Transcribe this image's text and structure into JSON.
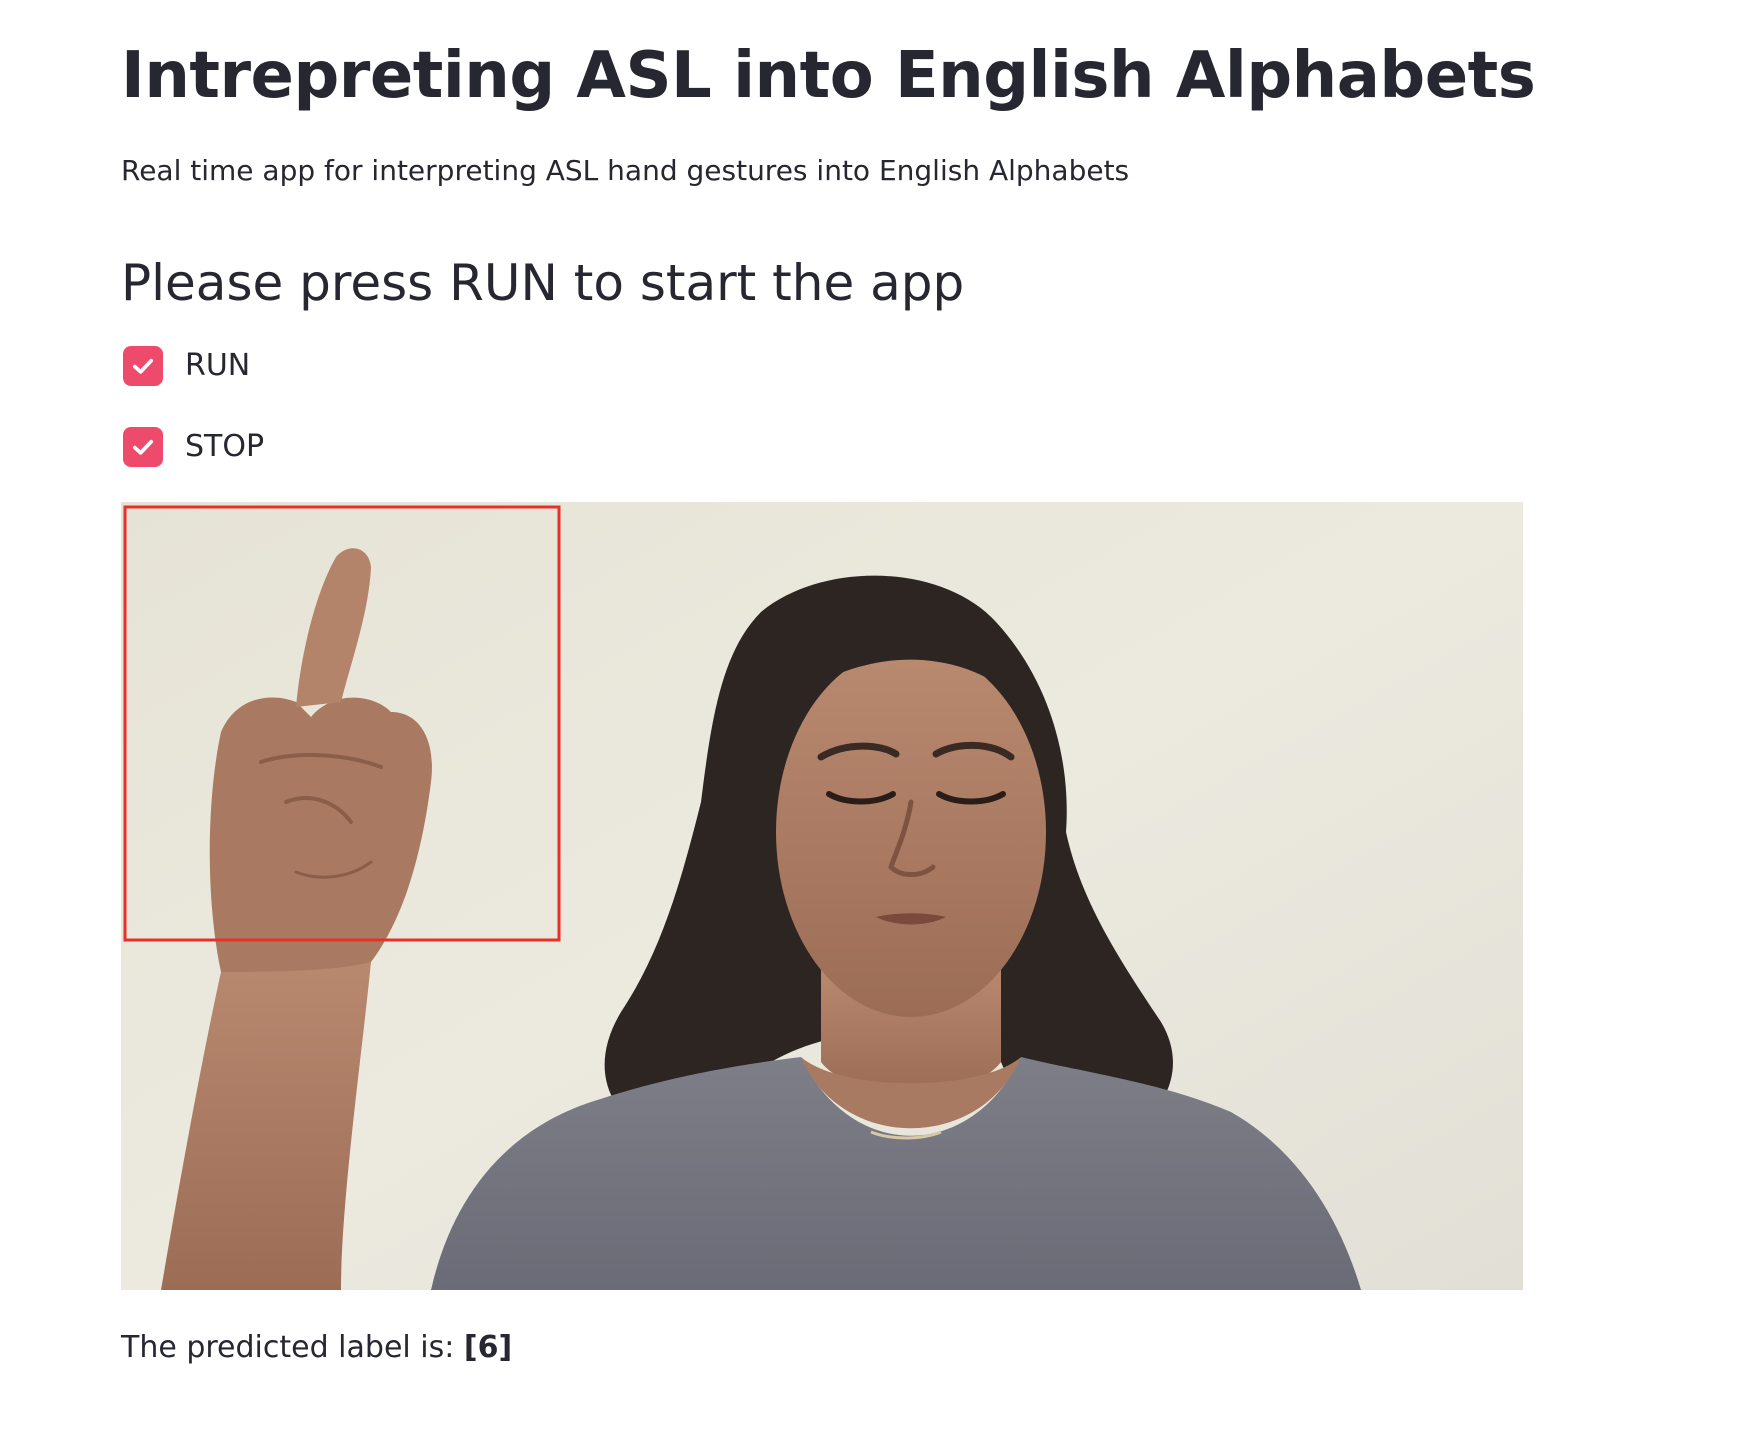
{
  "app": {
    "title": "Intrepreting ASL into English Alphabets",
    "subtitle": "Real time app for interpreting ASL hand gestures into English Alphabets"
  },
  "controls": {
    "heading": "Please press RUN to start the app",
    "checkboxes": [
      {
        "label": "RUN",
        "checked": true
      },
      {
        "label": "STOP",
        "checked": true
      }
    ]
  },
  "video": {
    "bounding_box_color": "#e8302a"
  },
  "result": {
    "prefix": "The predicted label is: ",
    "value": "[6]"
  },
  "theme": {
    "primary_color": "#ee4a6b",
    "text_color": "#262730"
  }
}
